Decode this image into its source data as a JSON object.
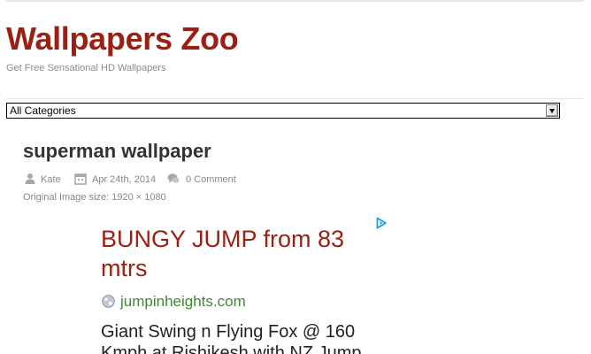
{
  "site": {
    "title": "Wallpapers Zoo",
    "tagline": "Get Free Sensational HD Wallpapers"
  },
  "category_select": {
    "selected": "All Categories"
  },
  "post": {
    "title": "superman wallpaper",
    "author": "Kate",
    "date": "Apr 24th, 2014",
    "comments": "0 Comment",
    "image_size": "Original Image size: 1920 × 1080"
  },
  "ad": {
    "headline": "BUNGY JUMP from 83 mtrs",
    "url": "jumpinheights.com",
    "description": "Giant Swing n Flying Fox @ 160 Kmph at Rishikesh with NZ Jump"
  },
  "colors": {
    "brand": "#9b1f12",
    "ad_url": "#3c8a2e",
    "meta_text": "#888888"
  },
  "icons": [
    "user-icon",
    "calendar-icon",
    "comment-icon",
    "adchoices-icon",
    "globe-icon",
    "chevron-down-icon"
  ]
}
